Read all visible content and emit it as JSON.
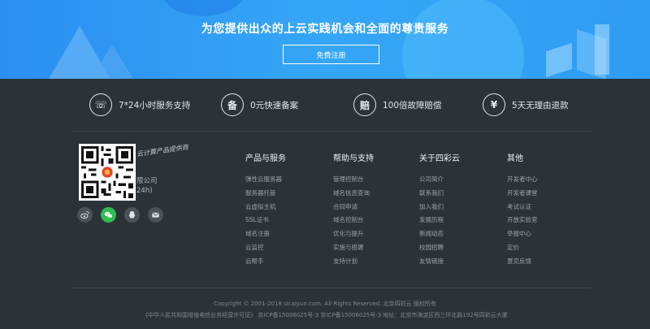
{
  "hero": {
    "title": "为您提供出众的上云实践机会和全面的尊贵服务",
    "button_label": "免费注册"
  },
  "features": [
    {
      "icon": "phone-icon",
      "glyph": "☏",
      "label": "7*24小时服务支持"
    },
    {
      "icon": "filing-icon",
      "glyph": "备",
      "label": "0元快速备案"
    },
    {
      "icon": "compensation-icon",
      "glyph": "赔",
      "label": "100倍故障赔偿"
    },
    {
      "icon": "refund-icon",
      "glyph": "¥",
      "label": "5天无理由退款"
    }
  ],
  "brand": {
    "slogan": "云计算产品提供商",
    "company_fragment": "限公司",
    "hours_fragment": "24h)"
  },
  "socials": [
    {
      "icon": "weibo-icon"
    },
    {
      "icon": "wechat-icon",
      "active": true
    },
    {
      "icon": "qq-icon"
    },
    {
      "icon": "mail-icon"
    }
  ],
  "columns": [
    {
      "title": "产品与服务",
      "items": [
        "弹性云服务器",
        "服务器托管",
        "云虚拟主机",
        "SSL证书",
        "域名注册",
        "云监控",
        "云帮手"
      ]
    },
    {
      "title": "帮助与支持",
      "items": [
        "管理控制台",
        "域名信息查询",
        "合同申请",
        "域名控制台",
        "优化与提升",
        "实施与搭建",
        "支持计划"
      ]
    },
    {
      "title": "关于四彩云",
      "items": [
        "公司简介",
        "联系我们",
        "加入我们",
        "发展历程",
        "新闻动态",
        "校园招聘",
        "友情链接"
      ]
    },
    {
      "title": "其他",
      "items": [
        "开发者中心",
        "开发者课堂",
        "考试认证",
        "开放实验室",
        "举报中心",
        "定价",
        "意见反馈"
      ]
    }
  ],
  "footer": {
    "copyright": "Copyright © 2001-2018 sicaiyun.com. All Rights Reserved. 北京四彩云 版权所有",
    "legal": "《中华人民共和国增值电信业务经营许可证》 京ICP备15006025号-3    京ICP备15006025号-3  地址：北京市海淀区西三环北路192号四彩云大厦"
  },
  "colors": {
    "hero_blue": "#2f9cf3",
    "footer_bg": "#2c3338",
    "wechat_green": "#2fbd52"
  }
}
